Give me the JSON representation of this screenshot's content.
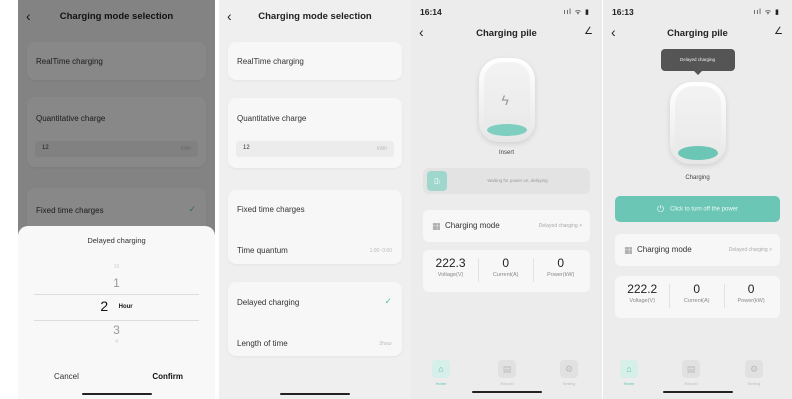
{
  "screen1": {
    "title": "Charging mode selection",
    "items": {
      "realtime": "RealTime charging",
      "quantitative": "Quantitative charge",
      "quantitative_value": "12",
      "quantitative_unit": "kWh",
      "fixed_time": "Fixed time charges"
    },
    "sheet": {
      "title": "Delayed charging",
      "picker": {
        "above2": "10",
        "above": "1",
        "selected": "2",
        "unit": "Hour",
        "below": "3",
        "below2": "4"
      },
      "cancel": "Cancel",
      "confirm": "Confirm"
    }
  },
  "screen2": {
    "title": "Charging mode selection",
    "items": {
      "realtime": "RealTime charging",
      "quantitative": "Quantitative charge",
      "quantitative_value": "12",
      "quantitative_unit": "kWh",
      "fixed_time": "Fixed time charges",
      "time_quantum": "Time quantum",
      "time_quantum_value": "1:00~3:00",
      "delayed": "Delayed charging",
      "length": "Length of time",
      "length_value": "2hour"
    }
  },
  "screen3": {
    "time": "16:14",
    "status_icons": "ııl ᯤ ▮",
    "title": "Charging pile",
    "charger_label": "Insert",
    "status_text": "Waiting for power on, delaying",
    "mode_label": "Charging mode",
    "mode_value": "Delayed charging  >",
    "metrics": [
      {
        "value": "222.3",
        "label": "Voltage(V)"
      },
      {
        "value": "0",
        "label": "Current(A)"
      },
      {
        "value": "0",
        "label": "Power(kW)"
      }
    ],
    "tabs": [
      "Home",
      "Record",
      "Setting"
    ]
  },
  "screen4": {
    "time": "16:13",
    "status_icons": "ııl ᯤ ▮",
    "title": "Charging pile",
    "tooltip": "Delayed charging",
    "charger_label": "Charging",
    "turn_off": "Click to turn off the power",
    "mode_label": "Charging mode",
    "mode_value": "Delayed charging  >",
    "metrics": [
      {
        "value": "222.2",
        "label": "Voltage(V)"
      },
      {
        "value": "0",
        "label": "Current(A)"
      },
      {
        "value": "0",
        "label": "Power(kW)"
      }
    ],
    "tabs": [
      "Home",
      "Record",
      "Setting"
    ]
  },
  "colors": {
    "accent": "#57c5b2",
    "button": "#6cc6b5",
    "card": "#f7f7f7",
    "background": "#efefef"
  }
}
